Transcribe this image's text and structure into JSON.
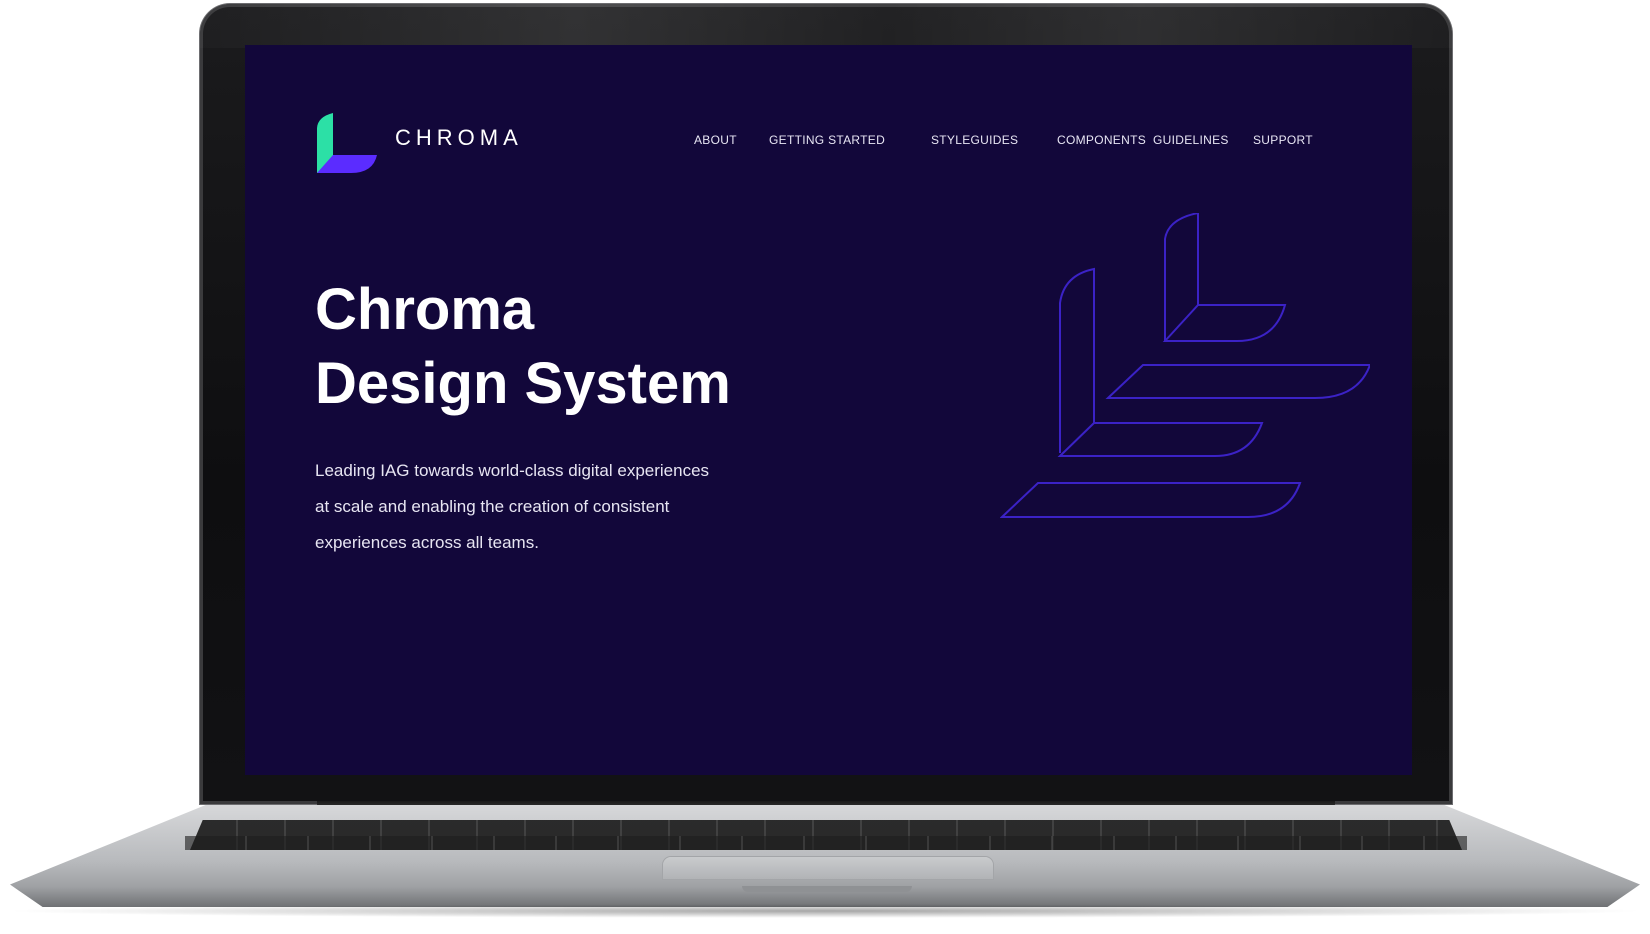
{
  "brand": {
    "name": "CHROMA",
    "colors": {
      "background": "#12073a",
      "logo_green": "#2ce0a6",
      "logo_purple": "#5b2cff",
      "art_stroke": "#3b22c6"
    },
    "logo_icon": "chroma-logo-icon"
  },
  "nav": {
    "items": [
      {
        "label": "ABOUT"
      },
      {
        "label": "GETTING STARTED"
      },
      {
        "label": "STYLEGUIDES"
      },
      {
        "label": "COMPONENTS"
      },
      {
        "label": "GUIDELINES"
      },
      {
        "label": "SUPPORT"
      }
    ]
  },
  "hero": {
    "title_line1": "Chroma",
    "title_line2": "Design System",
    "desc_line1": "Leading IAG towards world-class digital experiences",
    "desc_line2": "at scale and enabling the creation of consistent",
    "desc_line3": "experiences across all teams.",
    "art_icon": "layered-shapes-illustration"
  }
}
